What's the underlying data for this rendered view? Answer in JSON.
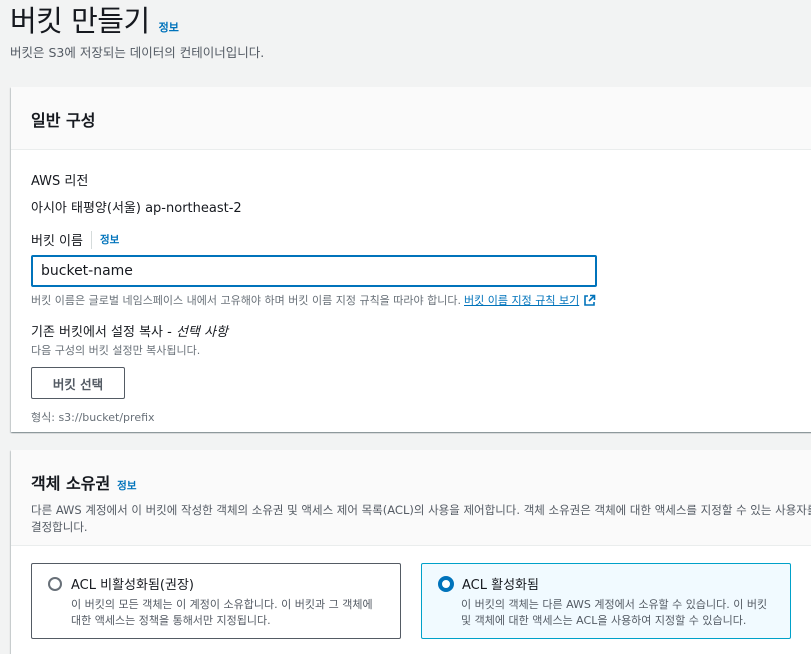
{
  "header": {
    "title": "버킷 만들기",
    "info": "정보",
    "subtitle": "버킷은 S3에 저장되는 데이터의 컨테이너입니다."
  },
  "general": {
    "title": "일반 구성",
    "region_label": "AWS 리전",
    "region_value": "아시아 태평양(서울) ap-northeast-2",
    "bucket_name_label": "버킷 이름",
    "bucket_name_info": "정보",
    "bucket_name_value": "bucket-name",
    "bucket_name_hint": "버킷 이름은 글로벌 네임스페이스 내에서 고유해야 하며 버킷 이름 지정 규칙을 따라야 합니다.",
    "rules_link": "버킷 이름 지정 규칙 보기",
    "copy_label": "기존 버킷에서 설정 복사 -",
    "copy_optional": "선택 사항",
    "copy_desc": "다음 구성의 버킷 설정만 복사됩니다.",
    "choose_bucket_button": "버킷 선택",
    "format_hint": "형식: s3://bucket/prefix"
  },
  "ownership": {
    "title": "객체 소유권",
    "info": "정보",
    "desc": "다른 AWS 계정에서 이 버킷에 작성한 객체의 소유권 및 액세스 제어 목록(ACL)의 사용을 제어합니다. 객체 소유권은 객체에 대한 액세스를 지정할 수 있는 사용자를 결정합니다.",
    "options": [
      {
        "label": "ACL 비활성화됨(권장)",
        "desc": "이 버킷의 모든 객체는 이 계정이 소유합니다. 이 버킷과 그 객체에 대한 액세스는 정책을 통해서만 지정됩니다.",
        "selected": false
      },
      {
        "label": "ACL 활성화됨",
        "desc": "이 버킷의 객체는 다른 AWS 계정에서 소유할 수 있습니다. 이 버킷 및 객체에 대한 액세스는 ACL을 사용하여 지정할 수 있습니다.",
        "selected": true
      }
    ]
  },
  "colors": {
    "link": "#0073bb",
    "selected_border": "#00a1c9",
    "selected_bg": "#f1faff"
  }
}
